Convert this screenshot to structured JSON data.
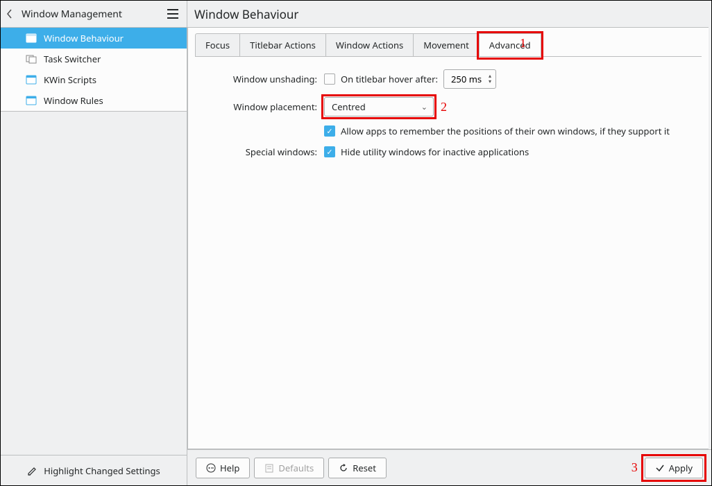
{
  "sidebar": {
    "back_label": "Window Management",
    "items": [
      {
        "label": "Window Behaviour"
      },
      {
        "label": "Task Switcher"
      },
      {
        "label": "KWin Scripts"
      },
      {
        "label": "Window Rules"
      }
    ],
    "footer_label": "Highlight Changed Settings"
  },
  "header": {
    "title": "Window Behaviour"
  },
  "tabs": [
    {
      "label": "Focus"
    },
    {
      "label": "Titlebar Actions"
    },
    {
      "label": "Window Actions"
    },
    {
      "label": "Movement"
    },
    {
      "label": "Advanced"
    }
  ],
  "form": {
    "unshading_label": "Window unshading:",
    "on_titlebar_hover_label": "On titlebar hover after:",
    "hover_delay_value": "250 ms",
    "placement_label": "Window placement:",
    "placement_value": "Centred",
    "allow_remember_label": "Allow apps to remember the positions of their own windows, if they support it",
    "special_label": "Special windows:",
    "hide_utility_label": "Hide utility windows for inactive applications"
  },
  "footer": {
    "help": "Help",
    "defaults": "Defaults",
    "reset": "Reset",
    "apply": "Apply"
  },
  "annotations": {
    "n1": "1",
    "n2": "2",
    "n3": "3"
  }
}
